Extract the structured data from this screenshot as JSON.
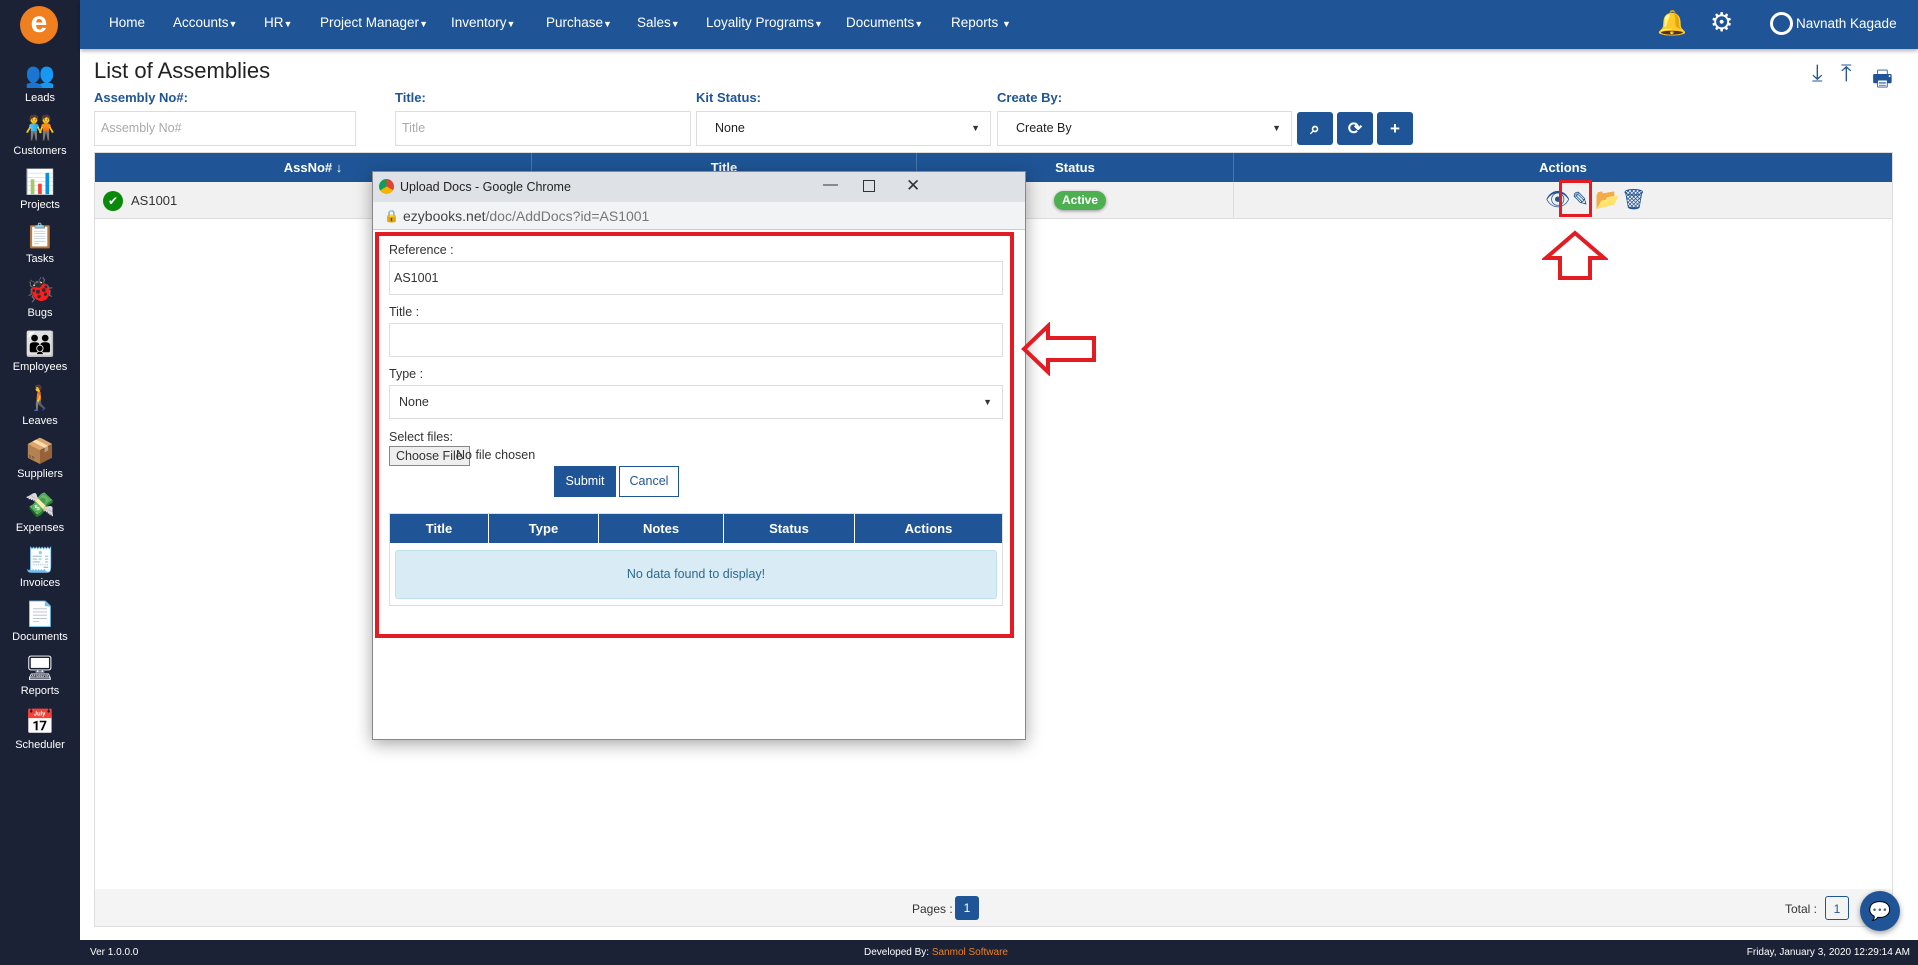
{
  "app": {
    "logo_letter": "e"
  },
  "sidebar": {
    "items": [
      {
        "label": "Leads",
        "icon": "leads-icon",
        "glyph": "👥"
      },
      {
        "label": "Customers",
        "icon": "customers-icon",
        "glyph": "🧑‍🤝‍🧑"
      },
      {
        "label": "Projects",
        "icon": "projects-icon",
        "glyph": "📊"
      },
      {
        "label": "Tasks",
        "icon": "tasks-icon",
        "glyph": "📋"
      },
      {
        "label": "Bugs",
        "icon": "bug-icon",
        "glyph": "🐞"
      },
      {
        "label": "Employees",
        "icon": "employees-icon",
        "glyph": "👪"
      },
      {
        "label": "Leaves",
        "icon": "leaves-icon",
        "glyph": "🚶"
      },
      {
        "label": "Suppliers",
        "icon": "suppliers-icon",
        "glyph": "📦"
      },
      {
        "label": "Expenses",
        "icon": "expenses-icon",
        "glyph": "💸"
      },
      {
        "label": "Invoices",
        "icon": "invoices-icon",
        "glyph": "🧾"
      },
      {
        "label": "Documents",
        "icon": "documents-icon",
        "glyph": "📄"
      },
      {
        "label": "Reports",
        "icon": "reports-icon",
        "glyph": "🖥"
      },
      {
        "label": "Scheduler",
        "icon": "calendar-icon",
        "glyph": "📅"
      }
    ]
  },
  "nav": {
    "items": [
      "Home",
      "Accounts",
      "HR",
      "Project Manager",
      "Inventory",
      "Purchase",
      "Sales",
      "Loyality Programs",
      "Documents",
      "Reports"
    ],
    "user": "Navnath Kagade"
  },
  "page": {
    "title": "List of Assemblies"
  },
  "filters": {
    "assembly_label": "Assembly No#:",
    "assembly_placeholder": "Assembly No#",
    "title_label": "Title:",
    "title_placeholder": "Title",
    "kit_label": "Kit Status:",
    "kit_value": "None",
    "createby_label": "Create By:",
    "createby_value": "Create By"
  },
  "table": {
    "headers": [
      "AssNo# ↓",
      "Title",
      "Status",
      "Actions"
    ],
    "rows": [
      {
        "assno": "AS1001",
        "title": "",
        "status": "Active"
      }
    ]
  },
  "pager": {
    "pages_label": "Pages :",
    "current_page": "1",
    "total_label": "Total :",
    "total": "1"
  },
  "footer": {
    "version": "Ver 1.0.0.0",
    "developed_by": "Developed By:",
    "developer": "Sanmol Software",
    "datetime": "Friday, January 3, 2020 12:29:14 AM"
  },
  "popup": {
    "window_title": "Upload Docs - Google Chrome",
    "url_host": "ezybooks.net",
    "url_path": "/doc/AddDocs?id=AS1001",
    "reference_label": "Reference :",
    "reference_value": "AS1001",
    "title_label": "Title :",
    "title_value": "",
    "type_label": "Type :",
    "type_value": "None",
    "files_label": "Select files:",
    "choose_file": "Choose File",
    "no_file": "No file chosen",
    "submit": "Submit",
    "cancel": "Cancel",
    "headers": [
      "Title",
      "Type",
      "Notes",
      "Status",
      "Actions"
    ],
    "empty": "No data found to display!"
  },
  "colors": {
    "primary": "#1f5596",
    "sidebar": "#1c2236",
    "accent": "#f07f1f",
    "highlight": "#e31b23",
    "active": "#4caf50"
  }
}
